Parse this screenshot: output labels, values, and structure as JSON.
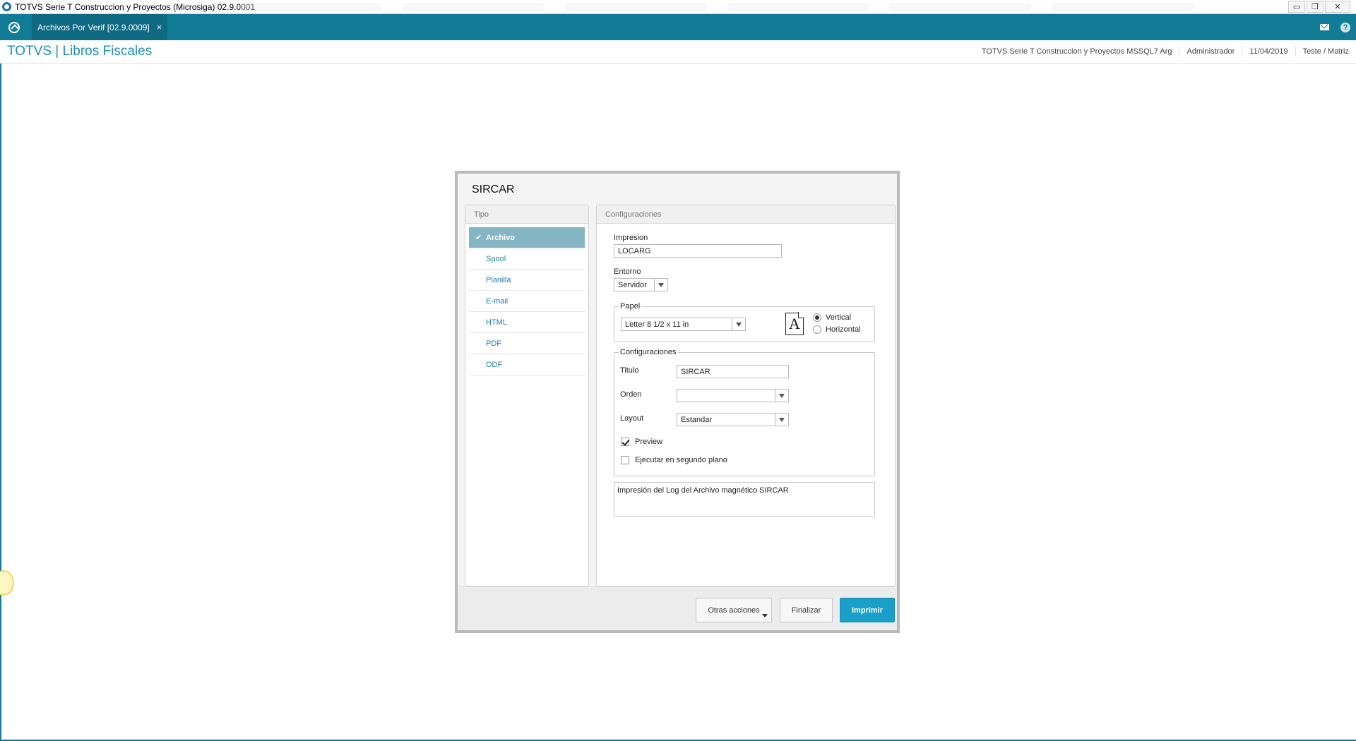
{
  "window": {
    "title": "TOTVS Serie T Construccion y Proyectos (Microsiga) 02.9.0001",
    "buttons": {
      "minimize": "▭",
      "restore": "❐",
      "close": "✕"
    }
  },
  "navbar": {
    "tab_label": "Archivos Por Verif [02.9.0009]",
    "tab_close": "×",
    "icons": [
      "mail-icon",
      "help-icon"
    ],
    "help_label": "?"
  },
  "header": {
    "module_title": "TOTVS | Libros Fiscales",
    "company": "TOTVS Serie T Construccion y Proyectos MSSQL7 Arg",
    "user": "Administrador",
    "date": "11/04/2019",
    "branch": "Teste / Matriz"
  },
  "dialog": {
    "title": "SIRCAR",
    "tipo": {
      "header": "Tipo",
      "items": [
        {
          "label": "Archivo",
          "selected": true
        },
        {
          "label": "Spool"
        },
        {
          "label": "Planilla"
        },
        {
          "label": "E-mail"
        },
        {
          "label": "HTML"
        },
        {
          "label": "PDF"
        },
        {
          "label": "ODF"
        }
      ]
    },
    "config": {
      "header": "Configuraciones",
      "impresion_label": "Impresion",
      "impresion_value": "LOCARG",
      "entorno_label": "Entorno",
      "entorno_value": "Servidor",
      "papel": {
        "legend": "Papel",
        "size_value": "Letter 8 1/2 x 11 in",
        "icon_letter": "A",
        "orientation_vertical": "Vertical",
        "orientation_horizontal": "Horizontal",
        "selected_orientation": "Vertical"
      },
      "configuraciones": {
        "legend": "Configuraciones",
        "titulo_label": "Titulo",
        "titulo_value": "SIRCAR",
        "orden_label": "Orden",
        "orden_value": "",
        "layout_label": "Layout",
        "layout_value": "Estandar",
        "preview_label": "Preview",
        "preview_checked": true,
        "segundo_plano_label": "Ejecutar en segundo plano",
        "segundo_plano_checked": false
      },
      "description": "Impresión del Log del Archivo magnético SIRCAR"
    },
    "footer": {
      "otras_acciones": "Otras acciones",
      "finalizar": "Finalizar",
      "imprimir": "Imprimir"
    }
  },
  "colors": {
    "nav_bar": "#127b96",
    "module_title": "#1c8fb8",
    "selected_item": "#84b5c3",
    "primary_button": "#1aa0c8"
  }
}
